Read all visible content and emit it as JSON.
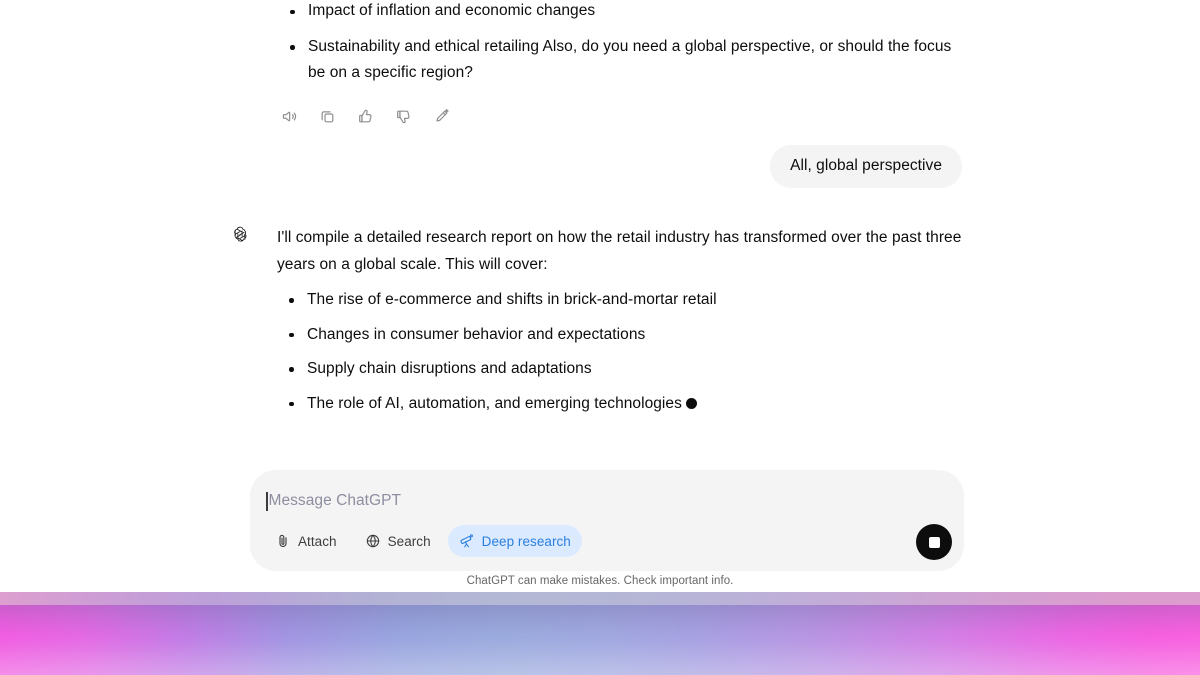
{
  "app": {
    "name": "ChatGPT"
  },
  "conversation": {
    "previous_assistant_message": {
      "bullets": [
        "Impact of inflation and economic changes",
        "Sustainability and ethical retailing Also, do you need a global perspective, or should the focus be on a specific region?"
      ],
      "actions": [
        {
          "name": "read-aloud",
          "label": "Read aloud",
          "icon": "speaker-icon"
        },
        {
          "name": "copy",
          "label": "Copy",
          "icon": "copy-icon"
        },
        {
          "name": "thumbs-up",
          "label": "Good response",
          "icon": "thumbs-up-icon"
        },
        {
          "name": "thumbs-down",
          "label": "Bad response",
          "icon": "thumbs-down-icon"
        },
        {
          "name": "edit-in-canvas",
          "label": "Edit",
          "icon": "pencil-sparkle-icon"
        }
      ]
    },
    "user_message": {
      "text": "All, global perspective"
    },
    "assistant_reply": {
      "avatar_icon": "openai-logo-icon",
      "paragraph": "I'll compile a detailed research report on how the retail industry has transformed over the past three years on a global scale. This will cover:",
      "bullets": [
        "The rise of e-commerce and shifts in brick-and-mortar retail",
        "Changes in consumer behavior and expectations",
        "Supply chain disruptions and adaptations",
        "The role of AI, automation, and emerging technologies"
      ],
      "is_streaming": true
    }
  },
  "composer": {
    "placeholder": "Message ChatGPT",
    "value": "",
    "tools": [
      {
        "name": "attach",
        "label": "Attach",
        "icon": "paperclip-icon",
        "active": false
      },
      {
        "name": "search",
        "label": "Search",
        "icon": "globe-icon",
        "active": false
      },
      {
        "name": "deep-research",
        "label": "Deep research",
        "icon": "telescope-icon",
        "active": true
      }
    ],
    "send_button": {
      "label": "Stop generating",
      "icon": "stop-square-icon",
      "state": "stop"
    }
  },
  "footer": {
    "disclaimer": "ChatGPT can make mistakes. Check important info."
  },
  "colors": {
    "accent_blue": "#2a7fe0",
    "accent_blue_bg": "#dbeafe",
    "bubble_gray": "#f4f4f4",
    "text_primary": "#0d0d0d",
    "text_muted": "#676767",
    "placeholder": "#8e8ea0",
    "send_button": "#0d0d0d",
    "gradient_pink": "#f055e0",
    "gradient_blue": "#96a6dc"
  }
}
